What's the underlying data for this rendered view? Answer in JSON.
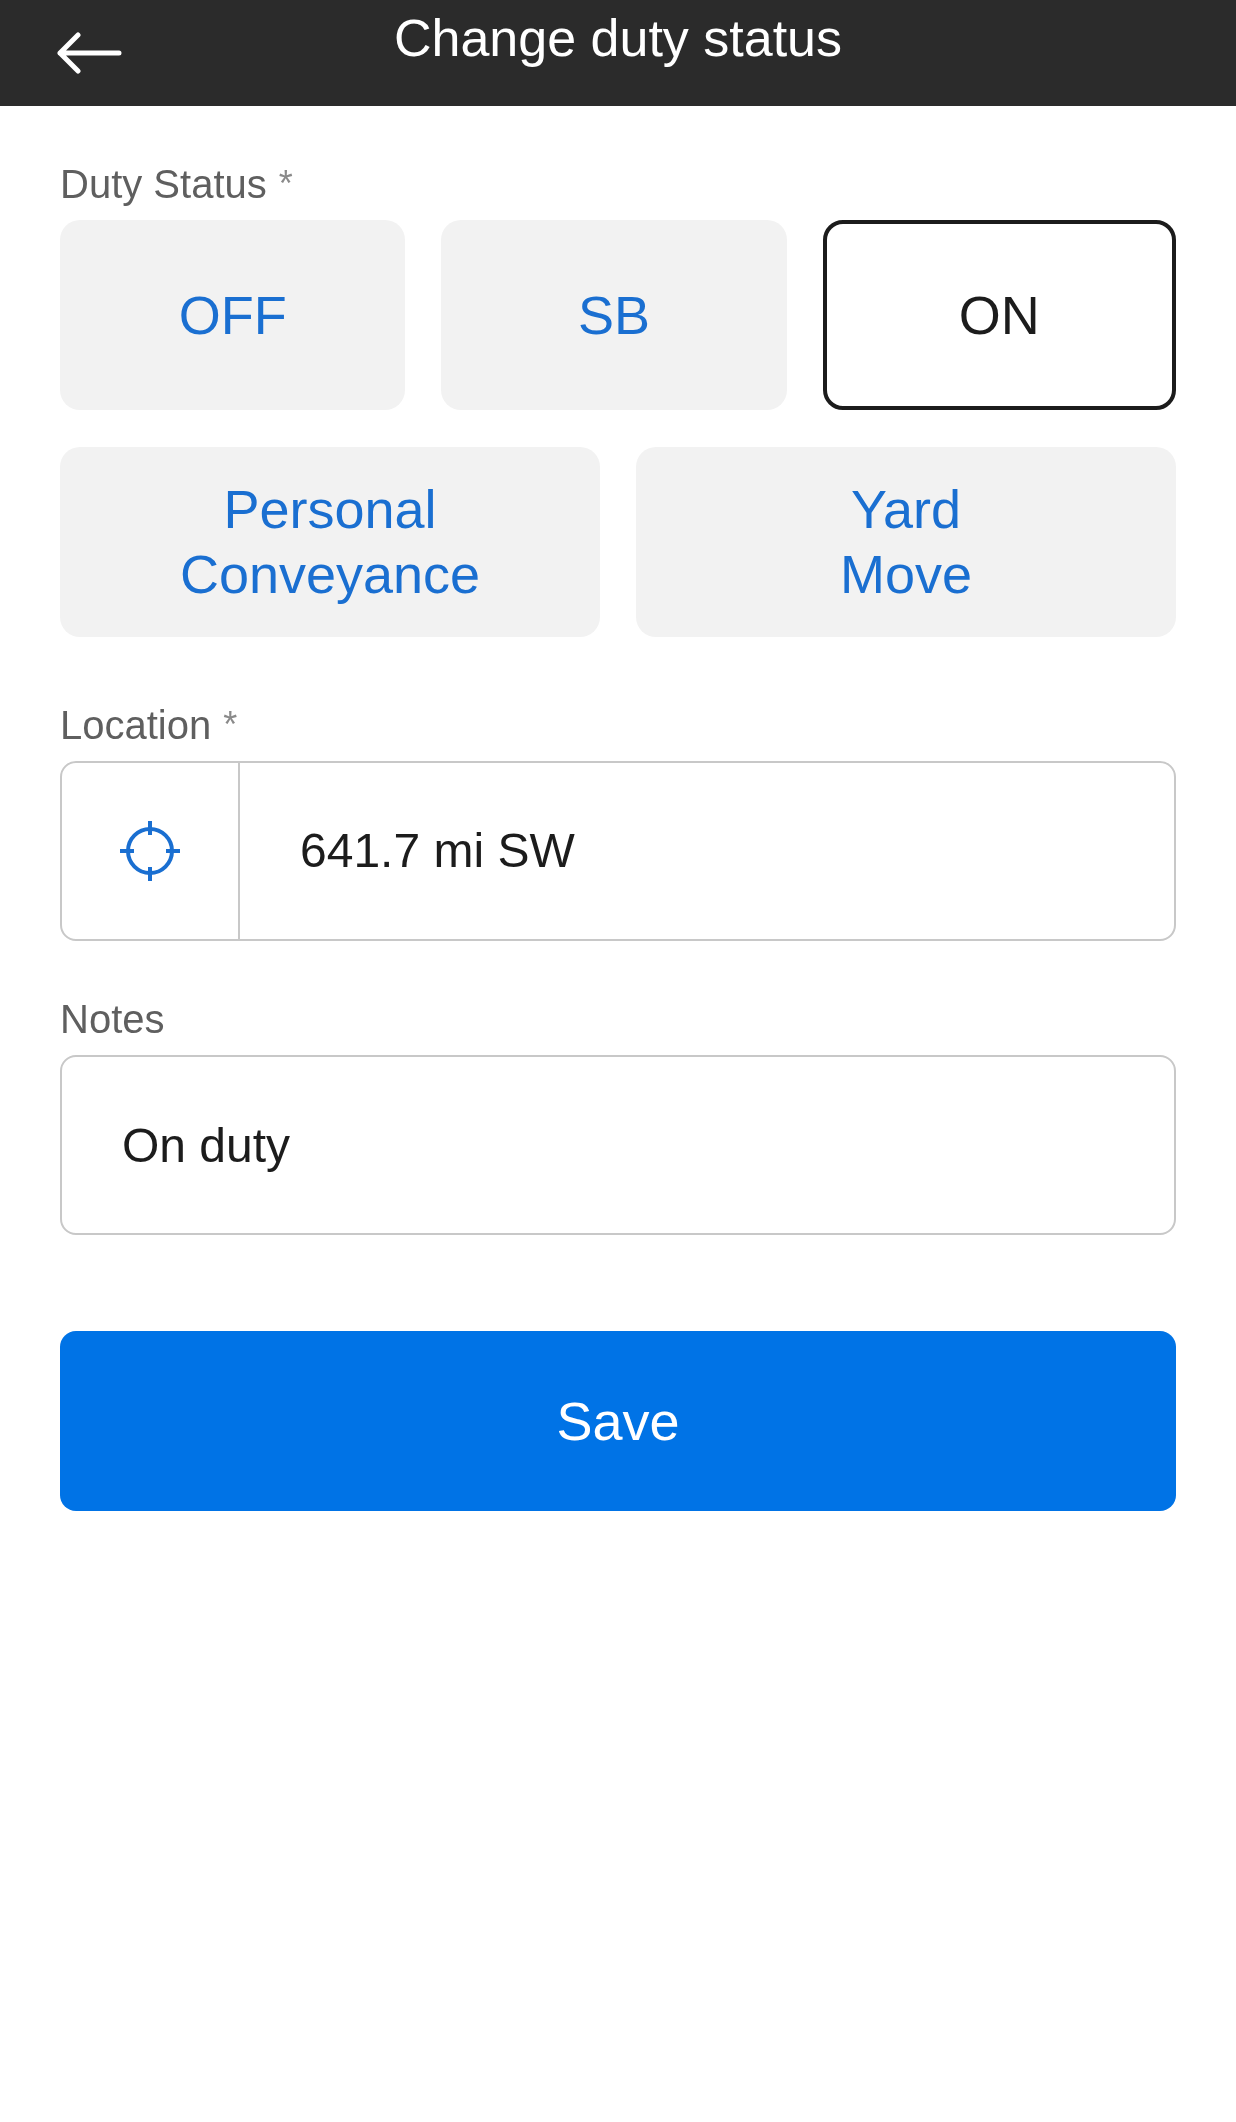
{
  "header": {
    "title": "Change duty status"
  },
  "duty_status": {
    "label": "Duty Status",
    "required_mark": "*",
    "options": [
      {
        "label": "OFF",
        "selected": false
      },
      {
        "label": "SB",
        "selected": false
      },
      {
        "label": "ON",
        "selected": true
      },
      {
        "label": "Personal Conveyance",
        "selected": false
      },
      {
        "label": "Yard Move",
        "selected": false
      }
    ]
  },
  "location": {
    "label": "Location",
    "required_mark": "*",
    "value": "641.7 mi SW"
  },
  "notes": {
    "label": "Notes",
    "value": "On duty"
  },
  "save_button": "Save"
}
